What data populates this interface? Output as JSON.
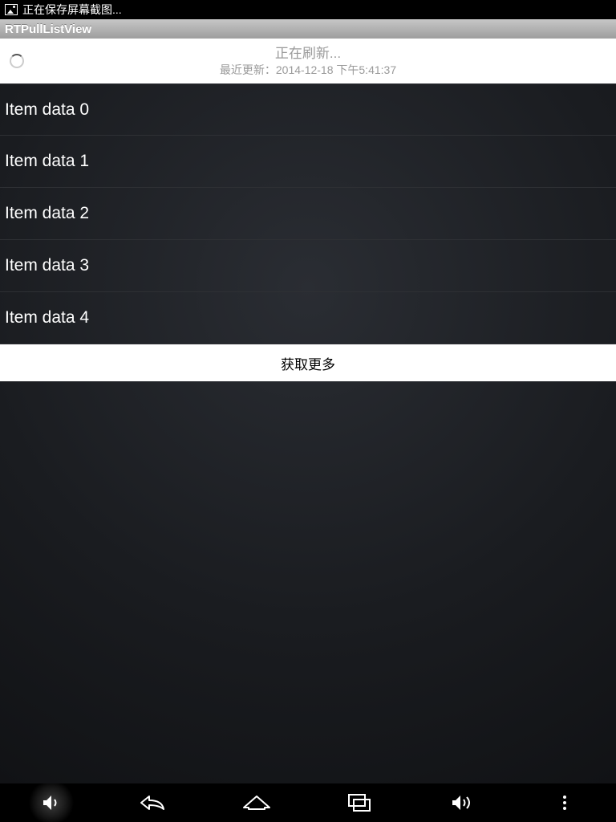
{
  "status_bar": {
    "text": "正在保存屏幕截图..."
  },
  "title_bar": {
    "title": "RTPullListView"
  },
  "refresh_header": {
    "status": "正在刷新...",
    "last_update_prefix": "最近更新：",
    "last_update_time": "2014-12-18 下午5:41:37"
  },
  "list": {
    "items": [
      {
        "label": "Item data 0"
      },
      {
        "label": "Item data 1"
      },
      {
        "label": "Item data 2"
      },
      {
        "label": "Item data 3"
      },
      {
        "label": "Item data 4"
      }
    ]
  },
  "load_more": {
    "label": "获取更多"
  }
}
